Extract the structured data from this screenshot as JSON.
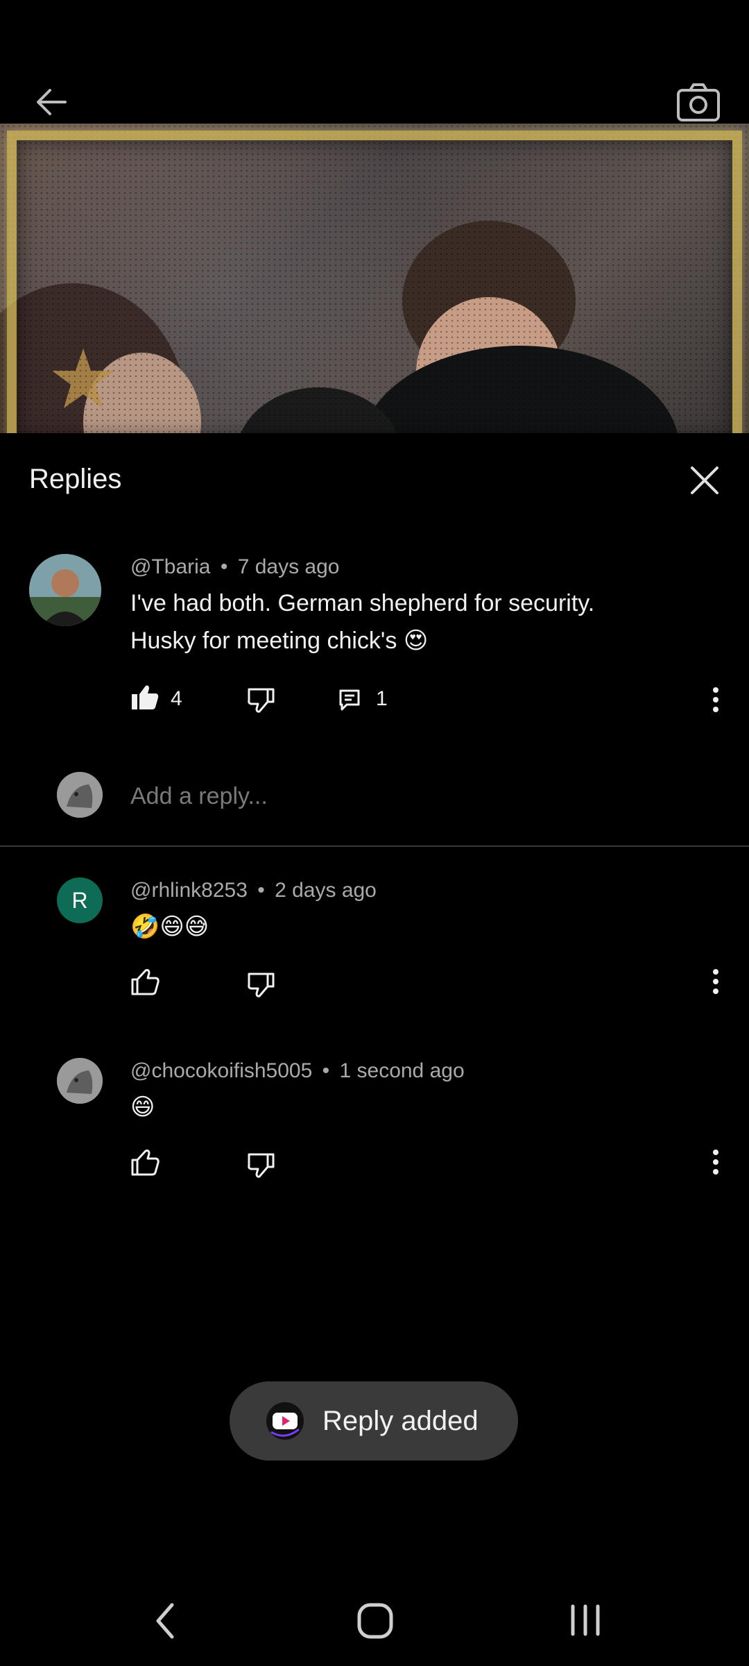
{
  "header": {
    "back_icon": "arrow-left-icon",
    "camera_icon": "camera-icon"
  },
  "sheet": {
    "title": "Replies",
    "close_icon": "close-icon"
  },
  "parent_comment": {
    "author": "@Tbaria",
    "time": "7 days ago",
    "text_line1": "I've had both.  German shepherd for security.",
    "text_line2": "Husky for meeting chick's 😍",
    "likes": "4",
    "replies": "1"
  },
  "reply_input": {
    "placeholder": "Add a reply..."
  },
  "replies": [
    {
      "avatar_letter": "R",
      "avatar_color": "#0e6b55",
      "author": "@rhlink8253",
      "time": "2 days ago",
      "text": "🤣😄😅"
    },
    {
      "author": "@chocokoifish5005",
      "time": "1 second ago",
      "text": "😄"
    }
  ],
  "separator": "•",
  "toast": {
    "text": "Reply added",
    "icon": "app-logo-icon"
  },
  "nav": {
    "back": "nav-back-icon",
    "home": "nav-home-icon",
    "recents": "nav-recents-icon"
  },
  "colors": {
    "background": "#000000",
    "secondary_text": "#aaaaaa",
    "toast_bg": "#3a3a3a"
  }
}
